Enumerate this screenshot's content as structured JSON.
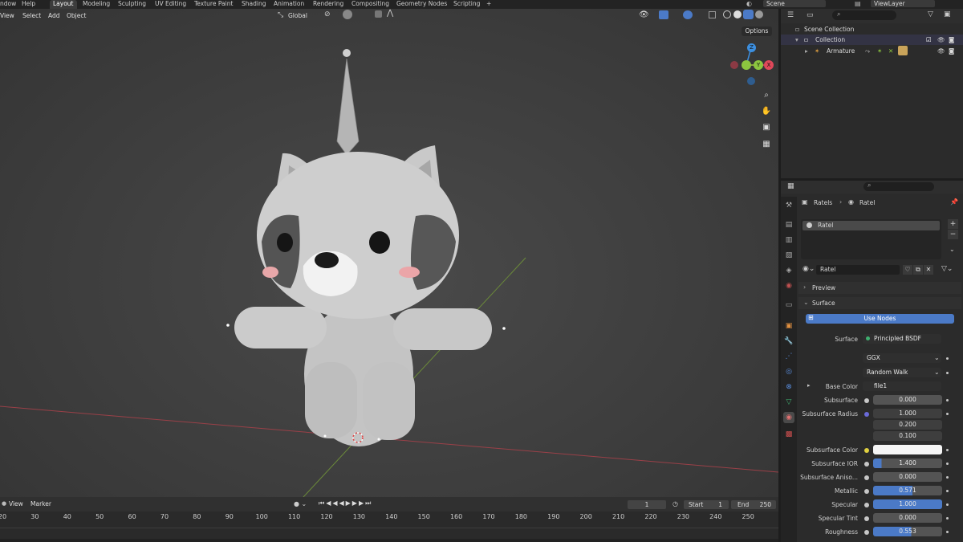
{
  "topbar": {
    "menu": [
      "ndow",
      "Help"
    ],
    "workspaces": [
      "Layout",
      "Modeling",
      "Sculpting",
      "UV Editing",
      "Texture Paint",
      "Shading",
      "Animation",
      "Rendering",
      "Compositing",
      "Geometry Nodes",
      "Scripting",
      "+"
    ],
    "active_workspace": "Layout",
    "scene": "Scene",
    "view_layer": "ViewLayer"
  },
  "viewport": {
    "menu": [
      "View",
      "Select",
      "Add",
      "Object"
    ],
    "transform_orientation": "Global",
    "options": "Options",
    "axis_labels": {
      "x": "X",
      "y": "Y",
      "z": "Z"
    }
  },
  "timeline": {
    "menu": [
      "View",
      "Marker"
    ],
    "current_frame": "1",
    "start_label": "Start",
    "start_value": "1",
    "end_label": "End",
    "end_value": "250",
    "ruler": [
      "20",
      "30",
      "40",
      "50",
      "60",
      "70",
      "80",
      "90",
      "100",
      "110",
      "120",
      "130",
      "140",
      "150",
      "160",
      "170",
      "180",
      "190",
      "200",
      "210",
      "220",
      "230",
      "240",
      "250"
    ]
  },
  "outliner": {
    "scene_collection": "Scene Collection",
    "collection": "Collection",
    "armature": "Armature"
  },
  "properties": {
    "breadcrumb_object": "Ratels",
    "breadcrumb_material": "Ratel",
    "slot_name": "Ratel",
    "material_name": "Ratel",
    "preview": "Preview",
    "surface_panel": "Surface",
    "use_nodes": "Use Nodes",
    "surface_label": "Surface",
    "surface_value": "Principled BSDF",
    "distribution": "GGX",
    "subsurface_method": "Random Walk",
    "rows": [
      {
        "label": "Base Color",
        "value": "file1"
      },
      {
        "label": "Subsurface",
        "value": "0.000"
      },
      {
        "label": "Subsurface Radius",
        "value": "1.000"
      },
      {
        "label": "",
        "value": "0.200"
      },
      {
        "label": "",
        "value": "0.100"
      },
      {
        "label": "Subsurface Color",
        "value": ""
      },
      {
        "label": "Subsurface IOR",
        "value": "1.400"
      },
      {
        "label": "Subsurface Aniso...",
        "value": "0.000"
      },
      {
        "label": "Metallic",
        "value": "0.571"
      },
      {
        "label": "Specular",
        "value": "1.000"
      },
      {
        "label": "Specular Tint",
        "value": "0.000"
      },
      {
        "label": "Roughness",
        "value": "0.553"
      }
    ]
  },
  "colors": {
    "accent": "#4b7ac7",
    "x_axis": "#e0485a",
    "y_axis": "#8cc63f",
    "z_axis": "#3c8fe0"
  }
}
